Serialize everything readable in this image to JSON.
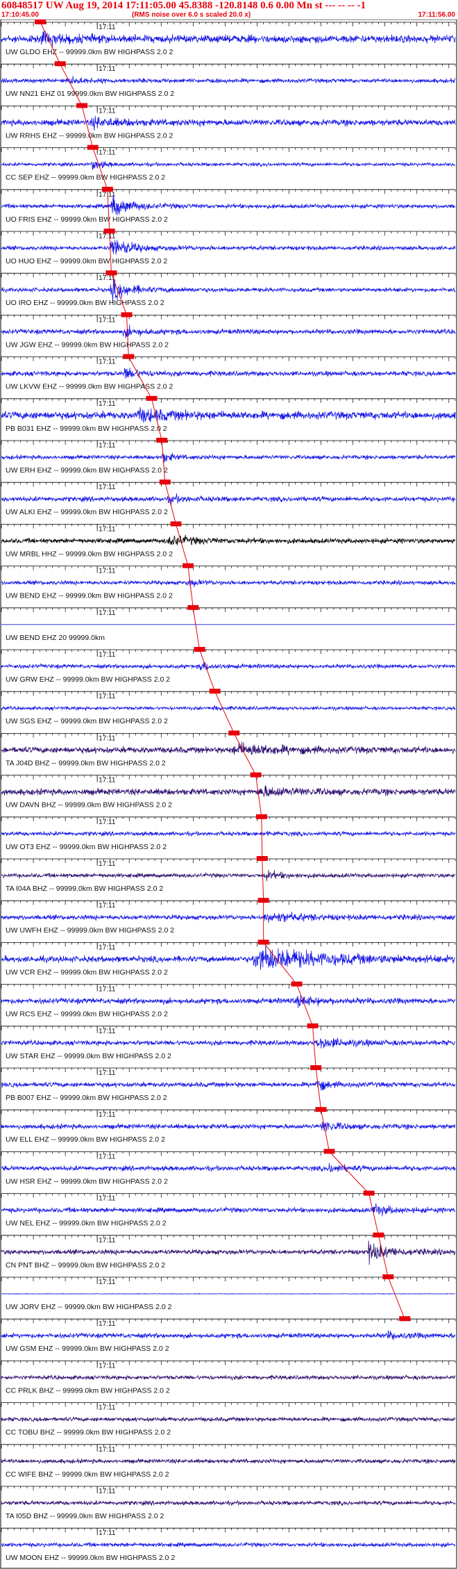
{
  "header": {
    "title": "60848517 UW Aug 19, 2014 17:11:05.00   45.8388 -120.8148  0.6 0.00 Mn st --- -- --   -1",
    "start_time": "17:10:45.00",
    "subtitle": "(RMS noise over 6.0 s scaled 20.0 x)",
    "end_time": "17:11:56.00"
  },
  "colors": {
    "trace": "#1515e6",
    "trace_dark": "#2a0e6e",
    "trace_black": "#000000",
    "pick": "#e8000b",
    "axis": "#000000"
  },
  "chart_data": {
    "type": "line",
    "title": "60848517 UW Aug 19, 2014 17:11:05.00   45.8388 -120.8148  0.6 0.00 Mn st --- -- --   -1",
    "x_range_seconds": [
      0,
      71
    ],
    "minute_tick_label": "17:11",
    "minute_tick_second": 15,
    "traces": [
      {
        "label": "UW GLDO EHZ -- 99999.0km BW  HIGHPASS  2.0  2",
        "pick": 6.1,
        "amp": 0.55,
        "burst": [
          6,
          10,
          0.6
        ],
        "color": "trace"
      },
      {
        "label": "UW NN21 EHZ 01 99999.0km BW  HIGHPASS  2.0  2",
        "pick": 9.2,
        "amp": 0.3,
        "burst": [
          10,
          8,
          0.4
        ],
        "color": "trace"
      },
      {
        "label": "UW RRHS EHZ -- 99999.0km BW  HIGHPASS  2.0  2",
        "pick": 12.6,
        "amp": 0.45,
        "burst": [
          14,
          10,
          0.6
        ],
        "color": "trace"
      },
      {
        "label": "CC SEP EHZ -- 99999.0km BW  HIGHPASS  2.0  2",
        "pick": 14.3,
        "amp": 0.25,
        "burst": [
          14,
          4,
          0.8
        ],
        "color": "trace"
      },
      {
        "label": "UO FRIS EHZ -- 99999.0km BW  HIGHPASS  2.0  2",
        "pick": 16.6,
        "amp": 0.3,
        "burst": [
          17,
          7,
          1.6
        ],
        "color": "trace"
      },
      {
        "label": "UO HUO EHZ -- 99999.0km BW  HIGHPASS  2.0  2",
        "pick": 16.9,
        "amp": 0.3,
        "burst": [
          17,
          7,
          1.6
        ],
        "color": "trace"
      },
      {
        "label": "UO IRO EHZ -- 99999.0km BW  HIGHPASS  2.0  2",
        "pick": 17.2,
        "amp": 0.3,
        "burst": [
          17,
          7,
          1.6
        ],
        "color": "trace"
      },
      {
        "label": "UW JGW EHZ -- 99999.0km BW  HIGHPASS  2.0  2",
        "pick": 19.6,
        "amp": 0.35,
        "burst": [
          19,
          6,
          0.7
        ],
        "color": "trace"
      },
      {
        "label": "UW LKVW EHZ -- 99999.0km BW  HIGHPASS  2.0  2",
        "pick": 19.9,
        "amp": 0.35,
        "burst": [
          19,
          6,
          0.8
        ],
        "color": "trace"
      },
      {
        "label": "PB B031 EHZ -- 99999.0km BW  HIGHPASS  2.0  2",
        "pick": 23.5,
        "amp": 0.55,
        "burst": [
          21,
          12,
          0.8
        ],
        "color": "trace"
      },
      {
        "label": "UW ERH EHZ -- 99999.0km BW  HIGHPASS  2.0  2",
        "pick": 25.1,
        "amp": 0.3,
        "burst": [
          25,
          4,
          0.7
        ],
        "color": "trace"
      },
      {
        "label": "UW ALKI EHZ -- 99999.0km BW  HIGHPASS  2.0  2",
        "pick": 25.6,
        "amp": 0.35,
        "burst": [
          26,
          6,
          0.5
        ],
        "color": "trace"
      },
      {
        "label": "UW MRBL HHZ -- 99999.0km BW  HIGHPASS  2.0  2",
        "pick": 27.3,
        "amp": 0.35,
        "burst": [
          26,
          10,
          0.7
        ],
        "color": "trace_black"
      },
      {
        "label": "UW BEND EHZ -- 99999.0km BW  HIGHPASS  2.0  2",
        "pick": 29.2,
        "amp": 0.3,
        "burst": [
          29,
          4,
          0.5
        ],
        "color": "trace"
      },
      {
        "label": "UW BEND EHZ 20 99999.0km",
        "pick": 30.0,
        "amp": 0.0,
        "burst": [
          30,
          0,
          0
        ],
        "color": "trace"
      },
      {
        "label": "UW GRW EHZ -- 99999.0km BW  HIGHPASS  2.0  2",
        "pick": 31.0,
        "amp": 0.3,
        "burst": [
          31,
          4,
          0.7
        ],
        "color": "trace"
      },
      {
        "label": "UW SGS EHZ -- 99999.0km BW  HIGHPASS  2.0  2",
        "pick": 33.4,
        "amp": 0.25,
        "burst": [
          33,
          3,
          0.3
        ],
        "color": "trace"
      },
      {
        "label": "TA J04D BHZ -- 99999.0km BW  HIGHPASS  2.0  2",
        "pick": 36.4,
        "amp": 0.45,
        "burst": [
          36,
          18,
          0.8
        ],
        "color": "trace_dark"
      },
      {
        "label": "UW DAVN BHZ -- 99999.0km BW  HIGHPASS  2.0  2",
        "pick": 39.8,
        "amp": 0.45,
        "burst": [
          40,
          14,
          0.6
        ],
        "color": "trace_dark"
      },
      {
        "label": "UW OT3 EHZ -- 99999.0km BW  HIGHPASS  2.0  2",
        "pick": 40.7,
        "amp": 0.3,
        "burst": [
          41,
          3,
          0.3
        ],
        "color": "trace"
      },
      {
        "label": "TA I04A BHZ -- 99999.0km BW  HIGHPASS  2.0  2",
        "pick": 40.8,
        "amp": 0.3,
        "burst": [
          41,
          6,
          0.6
        ],
        "color": "trace_dark"
      },
      {
        "label": "UW UWFH EHZ -- 99999.0km BW  HIGHPASS  2.0  2",
        "pick": 41.0,
        "amp": 0.35,
        "burst": [
          41,
          14,
          0.7
        ],
        "color": "trace"
      },
      {
        "label": "UW VCR EHZ -- 99999.0km BW  HIGHPASS  2.0  2",
        "pick": 41.0,
        "amp": 0.45,
        "burst": [
          39,
          26,
          1.8
        ],
        "color": "trace"
      },
      {
        "label": "UW RCS EHZ -- 99999.0km BW  HIGHPASS  2.0  2",
        "pick": 46.2,
        "amp": 0.4,
        "burst": [
          46,
          8,
          0.7
        ],
        "color": "trace"
      },
      {
        "label": "UW STAR EHZ -- 99999.0km BW  HIGHPASS  2.0  2",
        "pick": 48.7,
        "amp": 0.35,
        "burst": [
          49,
          12,
          0.7
        ],
        "color": "trace"
      },
      {
        "label": "PB B007 EHZ -- 99999.0km BW  HIGHPASS  2.0  2",
        "pick": 49.2,
        "amp": 0.35,
        "burst": [
          49,
          4,
          1.0
        ],
        "color": "trace"
      },
      {
        "label": "UW ELL EHZ -- 99999.0km BW  HIGHPASS  2.0  2",
        "pick": 50.0,
        "amp": 0.35,
        "burst": [
          50,
          6,
          0.8
        ],
        "color": "trace"
      },
      {
        "label": "UW HSR EHZ -- 99999.0km BW  HIGHPASS  2.0  2",
        "pick": 51.3,
        "amp": 0.35,
        "burst": [
          51,
          6,
          0.6
        ],
        "color": "trace"
      },
      {
        "label": "UW NEL EHZ -- 99999.0km BW  HIGHPASS  2.0  2",
        "pick": 57.5,
        "amp": 0.35,
        "burst": [
          58,
          6,
          0.8
        ],
        "color": "trace"
      },
      {
        "label": "CN PNT BHZ -- 99999.0km BW  HIGHPASS  2.0  2",
        "pick": 59.0,
        "amp": 0.35,
        "burst": [
          57,
          8,
          1.4
        ],
        "color": "trace_dark"
      },
      {
        "label": "UW JORV EHZ -- 99999.0km BW  HIGHPASS  2.0  2",
        "pick": 60.5,
        "amp": 0.05,
        "burst": [
          60,
          0,
          0
        ],
        "color": "trace"
      },
      {
        "label": "UW GSM EHZ -- 99999.0km BW  HIGHPASS  2.0  2",
        "pick": 63.1,
        "amp": 0.35,
        "burst": [
          60,
          8,
          0.4
        ],
        "color": "trace"
      },
      {
        "label": "CC PRLK BHZ -- 99999.0km BW  HIGHPASS  2.0  2",
        "pick": null,
        "amp": 0.3,
        "burst": [
          0,
          0,
          0
        ],
        "color": "trace_dark"
      },
      {
        "label": "CC TOBU BHZ -- 99999.0km BW  HIGHPASS  2.0  2",
        "pick": null,
        "amp": 0.3,
        "burst": [
          0,
          0,
          0
        ],
        "color": "trace_dark"
      },
      {
        "label": "CC WIFE BHZ -- 99999.0km BW  HIGHPASS  2.0  2",
        "pick": null,
        "amp": 0.3,
        "burst": [
          0,
          0,
          0
        ],
        "color": "trace_dark"
      },
      {
        "label": "TA I05D BHZ -- 99999.0km BW  HIGHPASS  2.0  2",
        "pick": null,
        "amp": 0.3,
        "burst": [
          0,
          0,
          0
        ],
        "color": "trace_dark"
      },
      {
        "label": "UW MOON EHZ -- 99999.0km BW  HIGHPASS  2.0  2",
        "pick": null,
        "amp": 0.3,
        "burst": [
          0,
          0,
          0
        ],
        "color": "trace"
      }
    ]
  }
}
